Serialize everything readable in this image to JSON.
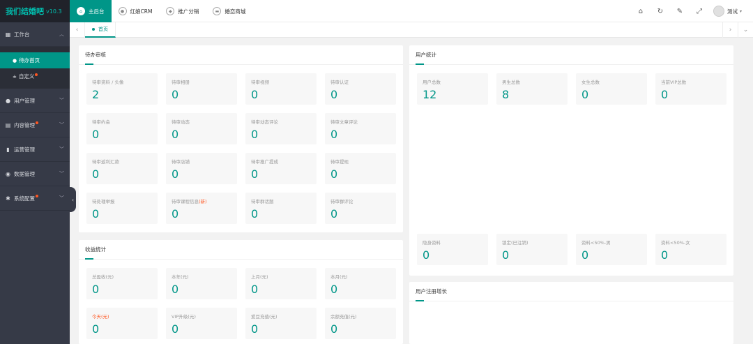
{
  "app": {
    "name": "我们结婚吧",
    "version": "v10.3"
  },
  "sidebar": {
    "workbench": "工作台",
    "sub_items": [
      {
        "label": "待办首页",
        "bullet": "●"
      },
      {
        "label": "自定义",
        "bullet": "±"
      }
    ],
    "items": [
      {
        "label": "用户管理",
        "icon": "user-icon"
      },
      {
        "label": "内容管理",
        "icon": "content-icon"
      },
      {
        "label": "运营管理",
        "icon": "chart-icon"
      },
      {
        "label": "数据管理",
        "icon": "database-icon"
      },
      {
        "label": "系统配置",
        "icon": "gear-icon"
      }
    ]
  },
  "topnav": {
    "tabs": [
      "主后台",
      "红娘CRM",
      "推广分销",
      "婚恋商城"
    ]
  },
  "user": {
    "name": "测试"
  },
  "tabsbar": {
    "current": "首页"
  },
  "pending": {
    "title": "待办审核",
    "items": [
      {
        "label": "待审资料 / 头像",
        "value": "2"
      },
      {
        "label": "待审相册",
        "value": "0"
      },
      {
        "label": "待审视频",
        "value": "0"
      },
      {
        "label": "待审认证",
        "value": "0"
      },
      {
        "label": "待审约会",
        "value": "0"
      },
      {
        "label": "待审动态",
        "value": "0"
      },
      {
        "label": "待审动态评论",
        "value": "0"
      },
      {
        "label": "待审文章评论",
        "value": "0"
      },
      {
        "label": "待审返利汇款",
        "value": "0"
      },
      {
        "label": "待审店铺",
        "value": "0"
      },
      {
        "label": "待审推广提成",
        "value": "0"
      },
      {
        "label": "待审提现",
        "value": "0"
      },
      {
        "label": "待处理举报",
        "value": "0"
      },
      {
        "label": "待审课程信息",
        "label_suffix": "(新)",
        "value": "0"
      },
      {
        "label": "待审群话题",
        "value": "0"
      },
      {
        "label": "待审群评论",
        "value": "0"
      }
    ]
  },
  "income": {
    "title": "收益统计",
    "items": [
      {
        "label": "总盈收(元)",
        "value": "0"
      },
      {
        "label": "本年(元)",
        "value": "0"
      },
      {
        "label": "上月(元)",
        "value": "0"
      },
      {
        "label": "本月(元)",
        "value": "0"
      },
      {
        "label": "今天(元)",
        "value": "0",
        "highlight": true
      },
      {
        "label": "VIP升级(元)",
        "value": "0"
      },
      {
        "label": "爱豆充值(元)",
        "value": "0"
      },
      {
        "label": "余额充值(元)",
        "value": "0"
      }
    ]
  },
  "user_stats": {
    "title": "用户统计",
    "top": [
      {
        "label": "用户总数",
        "value": "12"
      },
      {
        "label": "男生总数",
        "value": "8"
      },
      {
        "label": "女生总数",
        "value": "0"
      },
      {
        "label": "当前VIP总数",
        "value": "0"
      }
    ],
    "bottom": [
      {
        "label": "隐身资料",
        "value": "0"
      },
      {
        "label": "锁定(已注销)",
        "value": "0"
      },
      {
        "label": "资料<50%-男",
        "value": "0"
      },
      {
        "label": "资料<50%-女",
        "value": "0"
      }
    ]
  },
  "growth": {
    "title": "用户注册增长"
  },
  "colors": {
    "accent": "#009688",
    "sidebar": "#363a47",
    "alert": "#ff5722"
  }
}
